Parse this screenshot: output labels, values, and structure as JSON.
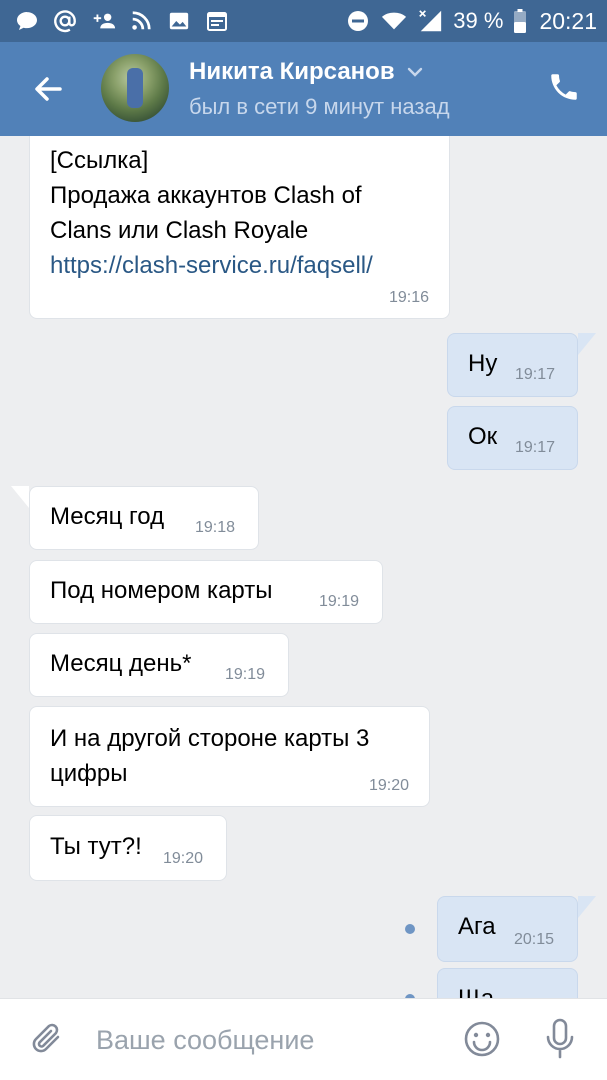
{
  "status_bar": {
    "battery": "39 %",
    "time": "20:21",
    "icons": [
      "chat-bubble-icon",
      "at-icon",
      "add-friend-icon",
      "rss-icon",
      "image-icon",
      "calendar-icon",
      "do-not-disturb-icon",
      "wifi-icon",
      "signal-icon",
      "battery-icon"
    ]
  },
  "header": {
    "name": "Никита Кирсанов",
    "status": "был в сети 9 минут назад"
  },
  "messages": [
    {
      "dir": "in",
      "lines": [
        "[Ссылка]",
        "Продажа аккаунтов Clash of",
        "Clans или Clash Royale"
      ],
      "link": "https://clash-service.ru/faqsell/",
      "time": "19:16"
    },
    {
      "dir": "out",
      "text": "Ну",
      "time": "19:17"
    },
    {
      "dir": "out",
      "text": "Ок",
      "time": "19:17"
    },
    {
      "dir": "in",
      "text": "Месяц год",
      "time": "19:18"
    },
    {
      "dir": "in",
      "text": "Под номером карты",
      "time": "19:19"
    },
    {
      "dir": "in",
      "text": "Месяц день*",
      "time": "19:19"
    },
    {
      "dir": "in",
      "lines": [
        "И на другой стороне карты 3",
        "цифры"
      ],
      "time": "19:20"
    },
    {
      "dir": "in",
      "text": "Ты тут?!",
      "time": "19:20"
    },
    {
      "dir": "out",
      "text": "Ага",
      "time": "20:15"
    },
    {
      "dir": "out",
      "text": "Ща",
      "time": ""
    }
  ],
  "composer": {
    "placeholder": "Ваше сообщение"
  },
  "colors": {
    "status_bar": "#3f6794",
    "header": "#5181b8",
    "chat_bg": "#edeef0",
    "incoming_bubble": "#ffffff",
    "outgoing_bubble": "#d9e5f4",
    "link": "#2a5885",
    "unread_dot": "#6f95c4"
  }
}
